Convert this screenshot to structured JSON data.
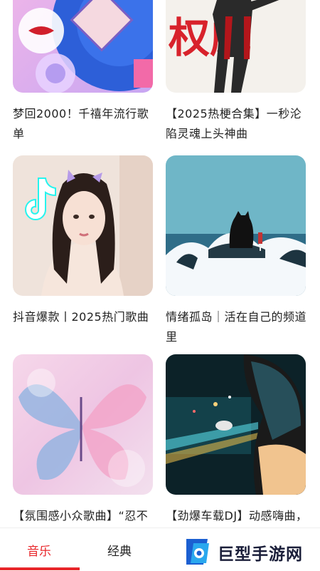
{
  "playlists": [
    {
      "title": "梦回2000！千禧年流行歌单",
      "cover": "y2k-vinyl-cover"
    },
    {
      "title": "【2025热梗合集】一秒沦陷灵魂上头神曲",
      "cover": "ultraman-cover"
    },
    {
      "title": "抖音爆款丨2025热门歌曲",
      "cover": "tiktok-girl-cover"
    },
    {
      "title": "情绪孤岛｜活在自己的频道里",
      "cover": "cat-island-cover"
    },
    {
      "title": "【氛围感小众歌曲】“忍不住单曲循环”",
      "cover": "butterfly-cover"
    },
    {
      "title": "【劲爆车载DJ】动感嗨曲，一脚踩到油箱",
      "cover": "night-car-cover"
    }
  ],
  "cover_text": {
    "ultraman": "权威"
  },
  "tabs": [
    {
      "label": "音乐",
      "active": true
    },
    {
      "label": "经典",
      "active": false
    }
  ],
  "watermark": {
    "text": "巨型手游网"
  },
  "colors": {
    "accent": "#e8262a"
  }
}
